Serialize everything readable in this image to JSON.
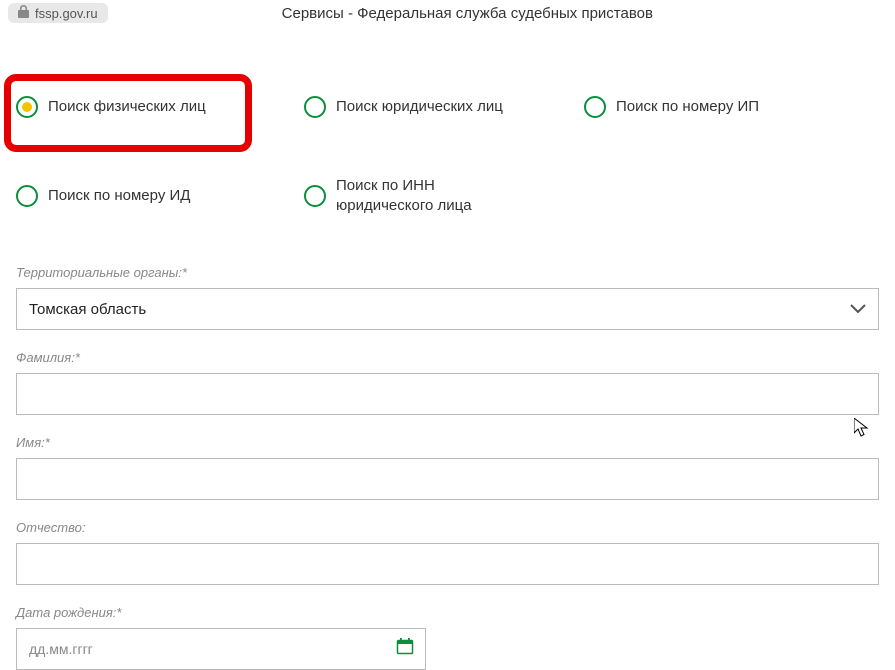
{
  "address_bar": {
    "url": "fssp.gov.ru",
    "title": "Сервисы - Федеральная служба судебных приставов"
  },
  "radios": {
    "r1": "Поиск физических лиц",
    "r2": "Поиск юридических лиц",
    "r3": "Поиск по номеру ИП",
    "r4": "Поиск по номеру ИД",
    "r5": "Поиск по ИНН юридического лица"
  },
  "form": {
    "region_label": "Территориальные органы:*",
    "region_value": "Томская область",
    "lastname_label": "Фамилия:*",
    "firstname_label": "Имя:*",
    "patronymic_label": "Отчество:",
    "dob_label": "Дата рождения:*",
    "dob_placeholder": "дд.мм.гггг"
  }
}
